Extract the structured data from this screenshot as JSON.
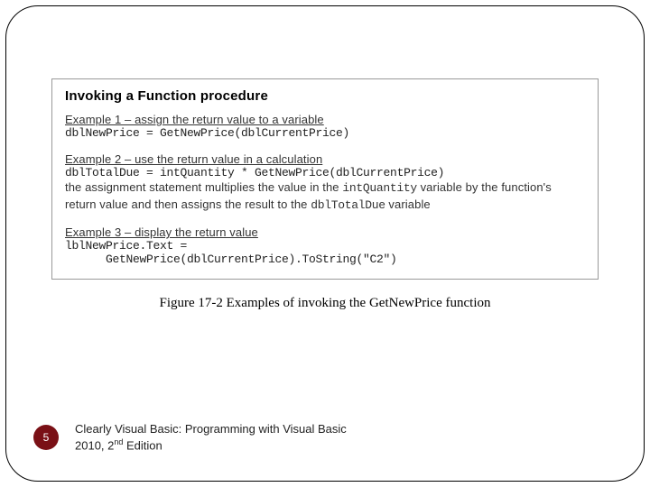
{
  "figure": {
    "heading": "Invoking a Function procedure",
    "ex1": {
      "label": "Example 1 – assign the return value to a variable",
      "code": "dblNewPrice = GetNewPrice(dblCurrentPrice)"
    },
    "ex2": {
      "label": "Example 2 – use the return value in a calculation",
      "code": "dblTotalDue = intQuantity * GetNewPrice(dblCurrentPrice)",
      "desc_a": "the assignment statement multiplies the value in the ",
      "desc_mono1": "intQuantity",
      "desc_b": " variable by the function's return value and then assigns the result to the ",
      "desc_mono2": "dblTotalDue",
      "desc_c": " variable"
    },
    "ex3": {
      "label": "Example 3 – display the return value",
      "code1": "lblNewPrice.Text =",
      "code2": "      GetNewPrice(dblCurrentPrice).ToString(\"C2\")"
    }
  },
  "caption": "Figure 17-2 Examples of invoking the GetNewPrice function",
  "footer": {
    "page": "5",
    "book_a": "Clearly Visual Basic: Programming with Visual Basic 2010, 2",
    "book_sup": "nd",
    "book_b": " Edition"
  }
}
